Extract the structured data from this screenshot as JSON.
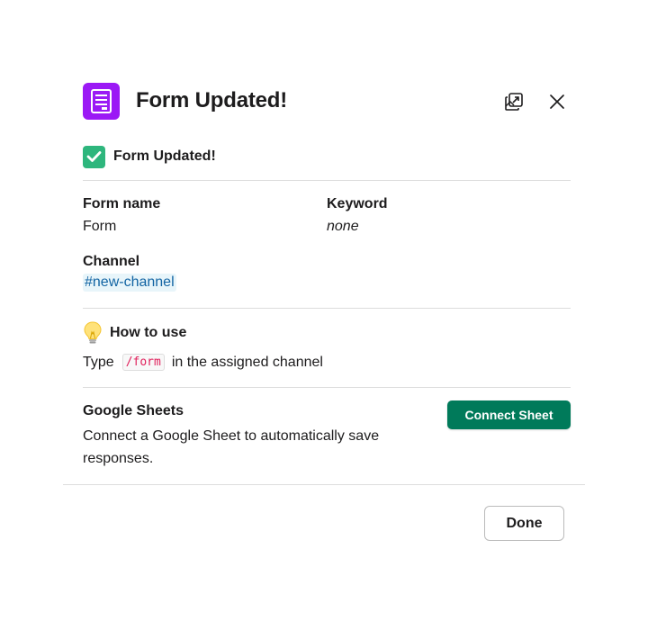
{
  "modal": {
    "title": "Form Updated!",
    "status_text": "Form Updated!",
    "fields": {
      "form_name_label": "Form name",
      "form_name_value": "Form",
      "keyword_label": "Keyword",
      "keyword_value": "none",
      "channel_label": "Channel",
      "channel_value": "#new-channel"
    },
    "how_to_use": {
      "heading": "How to use",
      "prefix": "Type",
      "command": "/form",
      "suffix": "in the assigned channel"
    },
    "google_sheets": {
      "title": "Google Sheets",
      "description": "Connect a Google Sheet to automatically save responses.",
      "button_label": "Connect Sheet"
    },
    "footer": {
      "done_label": "Done"
    }
  },
  "icons": {
    "app": "form-app-icon",
    "popout": "popout-icon",
    "close": "close-icon",
    "status": "check-mark-icon",
    "howto": "light-bulb-icon"
  },
  "colors": {
    "app_icon": "#9b19f5",
    "connect_button": "#007a5a",
    "channel_link": "#1264a3",
    "code_text": "#e01e5a",
    "check_green": "#2eb67d"
  }
}
